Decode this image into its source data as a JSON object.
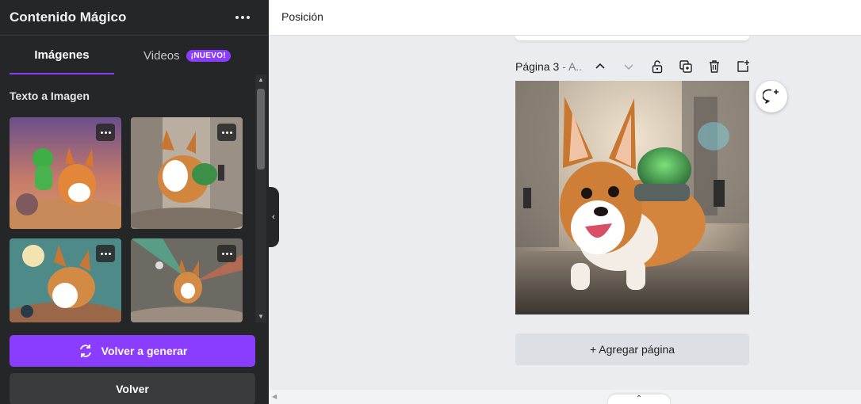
{
  "panel": {
    "title": "Contenido Mágico",
    "tabs": [
      {
        "label": "Imágenes",
        "active": true
      },
      {
        "label": "Videos",
        "badge": "¡NUEVO!"
      }
    ],
    "section_title": "Texto a Imagen",
    "regenerate_label": "Volver a generar",
    "back_label": "Volver"
  },
  "topbar": {
    "label": "Posición"
  },
  "page": {
    "label": "Página 3",
    "sub": " - A..",
    "add_page_label": "+ Agregar página"
  },
  "colors": {
    "accent": "#8b3dff",
    "panel_bg": "#252627",
    "canvas_bg": "#ebecf0"
  }
}
